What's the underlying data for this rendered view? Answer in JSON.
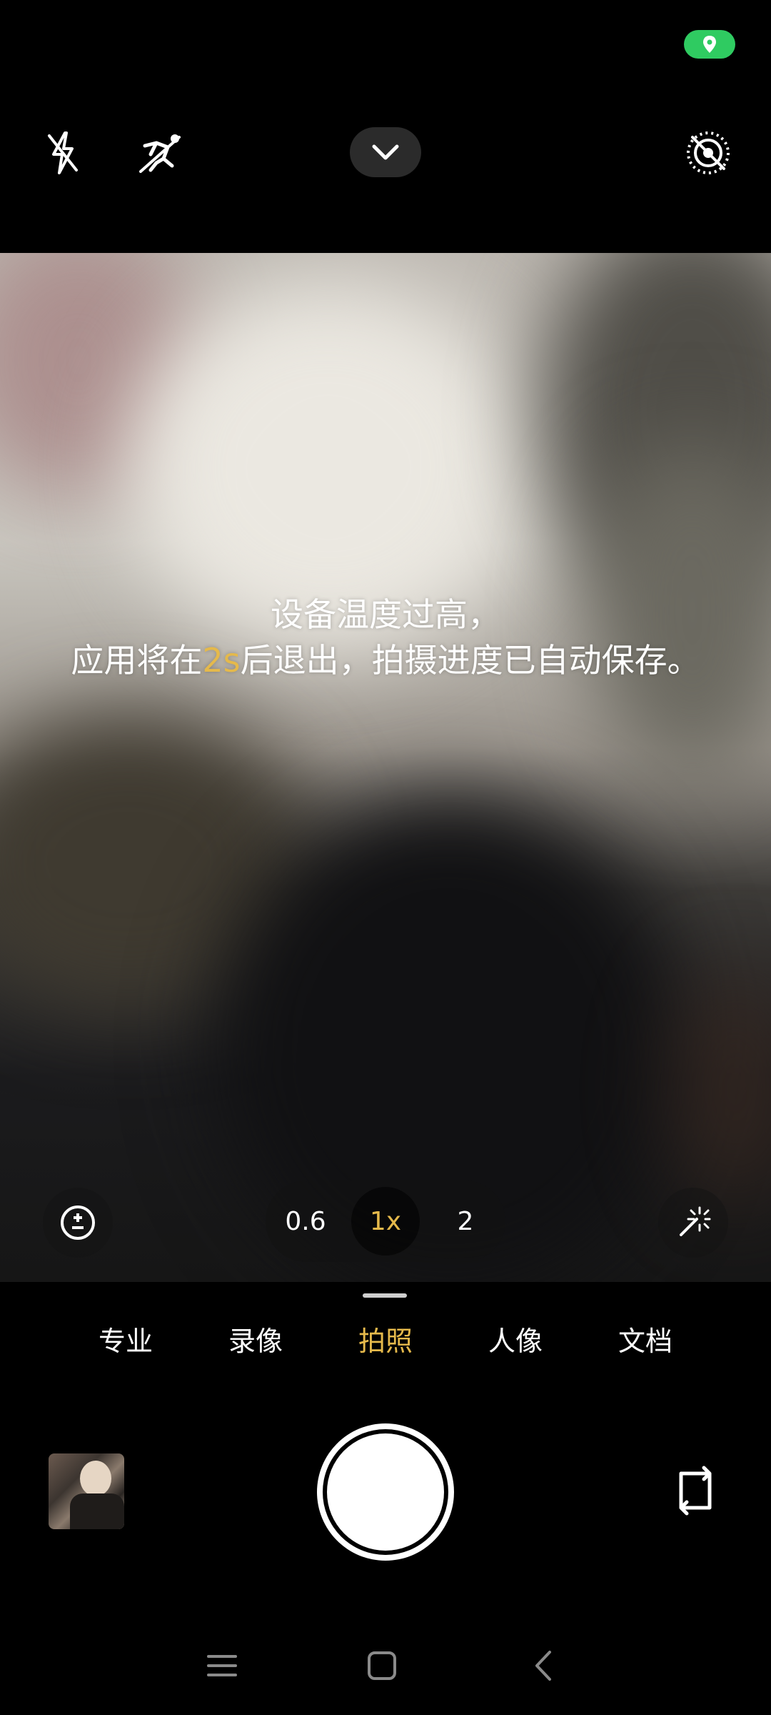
{
  "warning": {
    "line1": "设备温度过高，",
    "line2_before": "应用将在",
    "line2_highlight": "2s",
    "line2_after": "后退出，拍摄进度已自动保存。"
  },
  "zoom": {
    "options": [
      "0.6",
      "1x",
      "2"
    ],
    "selected": "1x"
  },
  "modes": {
    "items": [
      "专业",
      "录像",
      "拍照",
      "人像",
      "文档"
    ],
    "selected": "拍照"
  },
  "colors": {
    "accent": "#e5b94b",
    "location_pill": "#2fcb61"
  },
  "icons": {
    "top_bar": [
      "flash-off-icon",
      "motion-capture-icon",
      "chevron-down-icon",
      "live-photo-off-icon"
    ],
    "viewfinder": [
      "exposure-icon",
      "ai-scene-icon"
    ],
    "bottom": [
      "gallery-thumbnail",
      "shutter-button",
      "switch-camera-icon"
    ],
    "nav": [
      "menu-icon",
      "home-icon",
      "back-icon"
    ]
  }
}
